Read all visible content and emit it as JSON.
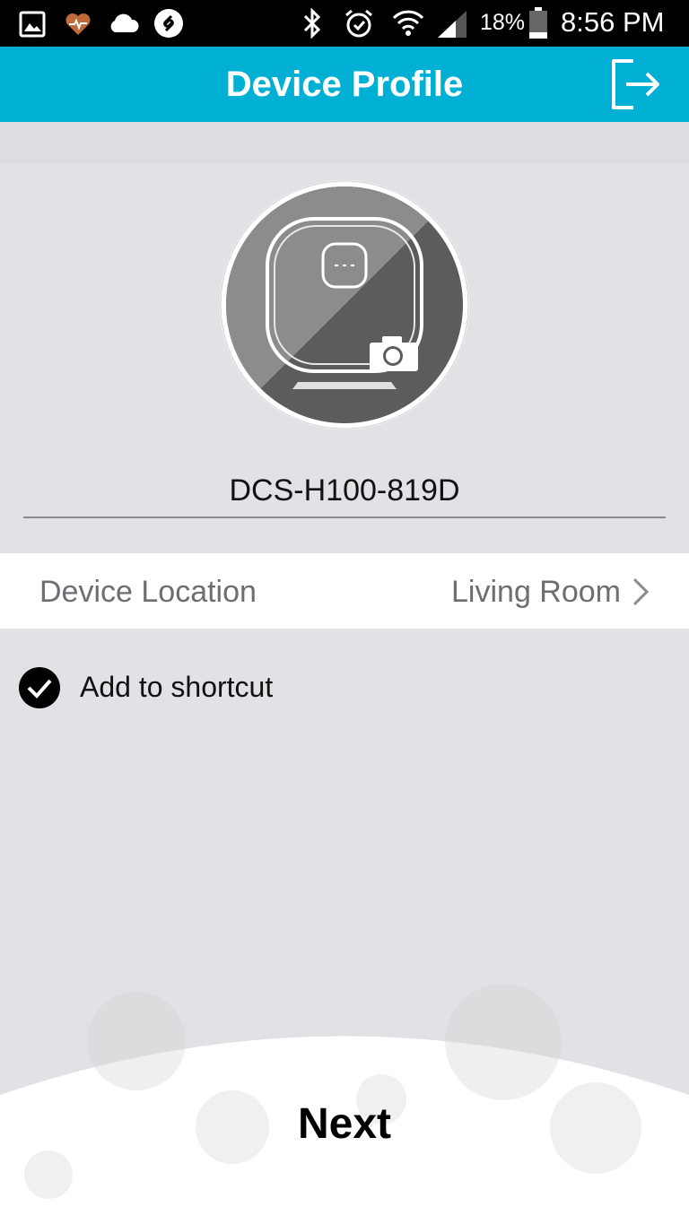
{
  "status_bar": {
    "icons": [
      "gallery-icon",
      "health-icon",
      "cloud-icon",
      "shazam-icon",
      "bluetooth-icon",
      "alarm-icon",
      "wifi-icon",
      "signal-icon",
      "battery-icon"
    ],
    "battery": "18%",
    "time": "8:56 PM"
  },
  "header": {
    "title": "Device Profile",
    "action_icon": "logout-icon",
    "background": "#00b0d4"
  },
  "profile": {
    "avatar_icon": "camera-device-icon",
    "photo_icon": "camera-icon",
    "device_name": "DCS-H100-819D"
  },
  "location": {
    "label": "Device Location",
    "value": "Living Room"
  },
  "shortcut": {
    "label": "Add to shortcut",
    "checked": true
  },
  "footer": {
    "next_label": "Next"
  }
}
